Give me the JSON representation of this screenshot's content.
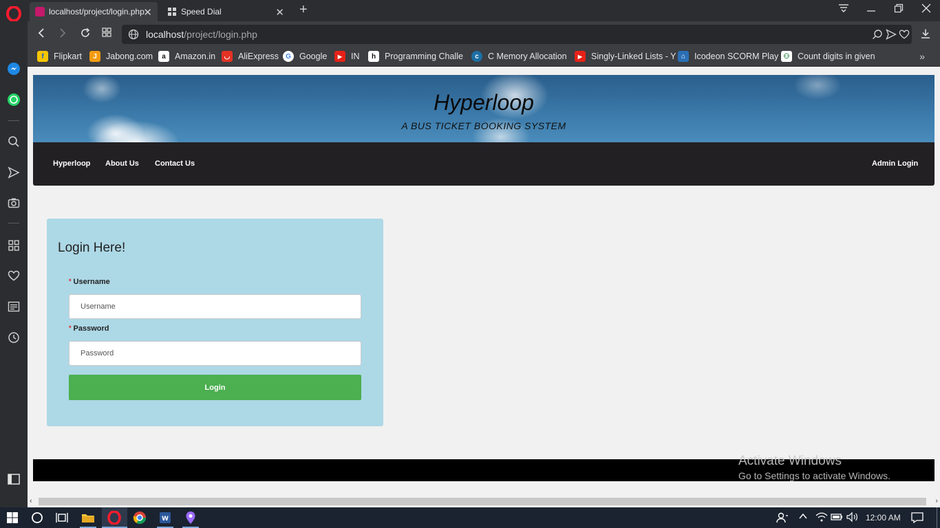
{
  "browser": {
    "tabs": [
      {
        "title": "localhost/project/login.php",
        "active": true
      },
      {
        "title": "Speed Dial",
        "active": false
      }
    ],
    "url_host": "localhost",
    "url_path": "/project/login.php",
    "bookmarks": [
      {
        "label": "Flipkart",
        "icon": "flipkart-icon",
        "color": "#f7c600",
        "glyph": "f"
      },
      {
        "label": "Jabong.com",
        "icon": "jabong-icon",
        "color": "#f39c12",
        "glyph": "J"
      },
      {
        "label": "Amazon.in",
        "icon": "amazon-icon",
        "color": "#ffffff",
        "glyph": "a"
      },
      {
        "label": "AliExpress",
        "icon": "aliexpress-icon",
        "color": "#e43225",
        "glyph": "◡"
      },
      {
        "label": "Google",
        "icon": "google-icon",
        "color": "#ffffff",
        "glyph": "G"
      },
      {
        "label": "IN",
        "icon": "youtube-icon",
        "color": "#e62117",
        "glyph": "▶"
      },
      {
        "label": "Programming Challe",
        "icon": "hackerrank-icon",
        "color": "#ffffff",
        "glyph": "h"
      },
      {
        "label": "C Memory Allocation",
        "icon": "codingame-icon",
        "color": "#1d6fa5",
        "glyph": "c"
      },
      {
        "label": "Singly-Linked Lists - Y",
        "icon": "youtube-icon",
        "color": "#e62117",
        "glyph": "▶"
      },
      {
        "label": "Icodeon SCORM Play",
        "icon": "icodeon-icon",
        "color": "#2a6fb5",
        "glyph": "⌂"
      },
      {
        "label": "Count digits in given",
        "icon": "geeksforgeeks-icon",
        "color": "#2f8d46",
        "glyph": "⚇"
      }
    ]
  },
  "site": {
    "title": "Hyperloop",
    "subtitle": "A BUS TICKET BOOKING SYSTEM",
    "nav": {
      "home": "Hyperloop",
      "about": "About Us",
      "contact": "Contact Us",
      "admin": "Admin Login"
    }
  },
  "login": {
    "heading": "Login Here!",
    "username_label": "Username",
    "username_placeholder": "Username",
    "password_label": "Password",
    "password_placeholder": "Password",
    "button": "Login",
    "required_mark": "*"
  },
  "watermark": {
    "line1": "Activate Windows",
    "line2": "Go to Settings to activate Windows."
  },
  "taskbar": {
    "clock": "12:00 AM"
  }
}
